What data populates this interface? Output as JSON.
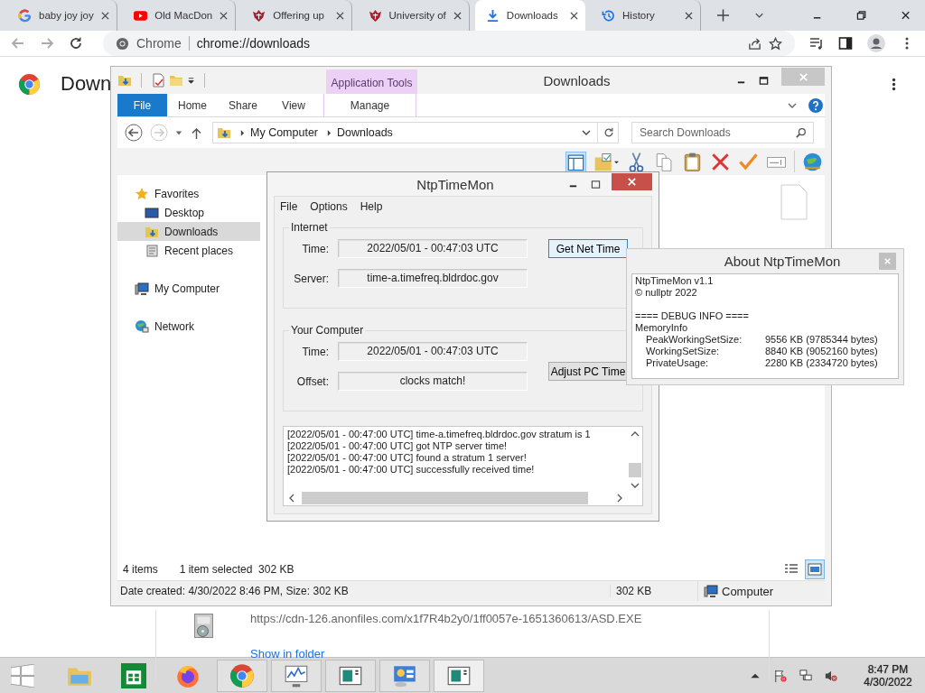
{
  "browser": {
    "tabs": [
      {
        "title": "baby joy joy",
        "kind": "google",
        "selected": false
      },
      {
        "title": "Old MacDon",
        "kind": "video",
        "selected": false
      },
      {
        "title": "Offering up",
        "kind": "crest",
        "selected": false
      },
      {
        "title": "University of",
        "kind": "crest",
        "selected": false
      },
      {
        "title": "Downloads",
        "kind": "download",
        "selected": true
      },
      {
        "title": "History",
        "kind": "history",
        "selected": false
      }
    ],
    "address": {
      "site": "Chrome",
      "url": "chrome://downloads"
    }
  },
  "page": {
    "heading": "Down",
    "download": {
      "url": "https://cdn-126.anonfiles.com/x1f7R4b2y0/1ff0057e-1651360613/ASD.EXE",
      "link": "Show in folder"
    }
  },
  "explorer": {
    "title": "Downloads",
    "context_group": "Application Tools",
    "ribbon_tabs": [
      {
        "label": "File",
        "kind": "file",
        "selected": false
      },
      {
        "label": "Home",
        "kind": "tab",
        "selected": false
      },
      {
        "label": "Share",
        "kind": "tab",
        "selected": false
      },
      {
        "label": "View",
        "kind": "tab",
        "selected": false
      },
      {
        "label": "Manage",
        "kind": "context",
        "selected": false
      }
    ],
    "breadcrumb": [
      "My Computer",
      "Downloads"
    ],
    "search": {
      "placeholder": "Search Downloads"
    },
    "nav": [
      {
        "label": "Favorites",
        "kind": "star",
        "selected": false,
        "children": [
          {
            "label": "Desktop",
            "kind": "desktop",
            "selected": false
          },
          {
            "label": "Downloads",
            "kind": "downloads",
            "selected": true
          },
          {
            "label": "Recent places",
            "kind": "recent",
            "selected": false
          }
        ]
      },
      {
        "label": "My Computer",
        "kind": "computer",
        "selected": false
      },
      {
        "label": "Network",
        "kind": "network",
        "selected": false
      }
    ],
    "status": {
      "items": "4 items",
      "selection": "1 item selected  302 KB"
    },
    "view_buttons": [
      {
        "kind": "details",
        "selected": false
      },
      {
        "kind": "tiles",
        "selected": true
      }
    ],
    "details": {
      "info": "Date created: 4/30/2022 8:46 PM, Size: 302 KB",
      "size": "302 KB",
      "zone": "Computer"
    }
  },
  "ntp": {
    "title": "NtpTimeMon",
    "menu": [
      "File",
      "Options",
      "Help"
    ],
    "groups": [
      {
        "title": "Internet",
        "button": "Get Net Time",
        "button_focused": true,
        "fields": [
          {
            "label": "Time:",
            "value": "2022/05/01 - 00:47:03 UTC"
          },
          {
            "label": "Server:",
            "value": "time-a.timefreq.bldrdoc.gov"
          }
        ]
      },
      {
        "title": "Your Computer",
        "button": "Adjust PC Time",
        "button_focused": false,
        "fields": [
          {
            "label": "Time:",
            "value": "2022/05/01 - 00:47:03 UTC"
          },
          {
            "label": "Offset:",
            "value": "clocks match!"
          }
        ]
      }
    ],
    "log": [
      "[2022/05/01 - 00:47:00 UTC] time-a.timefreq.bldrdoc.gov stratum is 1",
      "[2022/05/01 - 00:47:00 UTC] got NTP server time!",
      "[2022/05/01 - 00:47:00 UTC] found a stratum 1 server!",
      "[2022/05/01 - 00:47:00 UTC] successfully received time!"
    ]
  },
  "about": {
    "title": "About NtpTimeMon",
    "header_lines": [
      "NtpTimeMon v1.1",
      "© nullptr 2022"
    ],
    "debug_lines": [
      "==== DEBUG INFO ====",
      "MemoryInfo"
    ],
    "memory": [
      {
        "label": "PeakWorkingSetSize:",
        "value": "9556 KB (9785344 bytes)"
      },
      {
        "label": "WorkingSetSize:",
        "value": "8840 KB (9052160 bytes)"
      },
      {
        "label": "PrivateUsage:",
        "value": "2280 KB (2334720 bytes)"
      }
    ]
  },
  "taskbar": {
    "time": "8:47 PM",
    "date": "4/30/2022"
  }
}
